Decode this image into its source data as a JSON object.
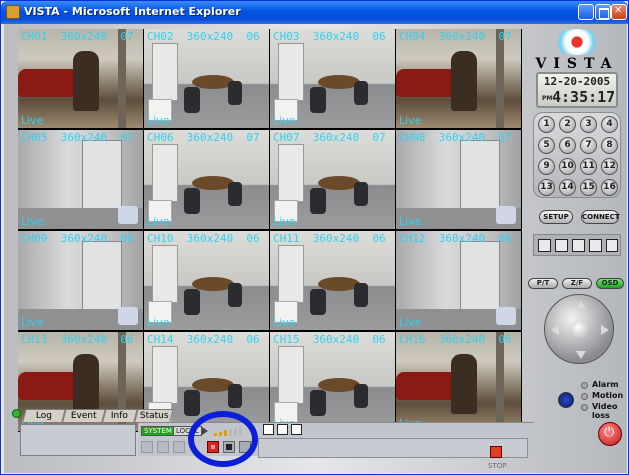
{
  "window": {
    "title": "VISTA - Microsoft Internet Explorer"
  },
  "cameras": [
    {
      "title": "CH01  360x240  07",
      "status": "Live",
      "scene": "outdoor"
    },
    {
      "title": "CH02  360x240  06",
      "status": "Live",
      "scene": "room"
    },
    {
      "title": "CH03  360x240  06",
      "status": "Live",
      "scene": "room"
    },
    {
      "title": "CH04  360x240  07",
      "status": "Live",
      "scene": "outdoor"
    },
    {
      "title": "CH05  360x240  07",
      "status": "Live",
      "scene": "hall"
    },
    {
      "title": "CH06  360x240  07",
      "status": "Live",
      "scene": "room"
    },
    {
      "title": "CH07  360x240  07",
      "status": "Live",
      "scene": "room"
    },
    {
      "title": "CH08  360x240  07",
      "status": "Live",
      "scene": "hall"
    },
    {
      "title": "CH09  360x240  06",
      "status": "Live",
      "scene": "hall"
    },
    {
      "title": "CH10  360x240  06",
      "status": "Live",
      "scene": "room"
    },
    {
      "title": "CH11  360x240  06",
      "status": "Live",
      "scene": "room"
    },
    {
      "title": "CH12  360x240  06",
      "status": "Live",
      "scene": "hall"
    },
    {
      "title": "CH13  360x240  06",
      "status": "Live",
      "scene": "outdoor"
    },
    {
      "title": "CH14  360x240  06",
      "status": "Live",
      "scene": "room"
    },
    {
      "title": "CH15  360x240  06",
      "status": "Live",
      "scene": "room"
    },
    {
      "title": "CH16  360x240  06",
      "status": "Live",
      "scene": "outdoor"
    }
  ],
  "tabs": [
    "Log",
    "Event",
    "Info",
    "Status"
  ],
  "playback": {
    "system_label": "SYSTEM",
    "local_label": "LOCAL",
    "stop_label": "STOP"
  },
  "brand": {
    "logo_text": "VISTA"
  },
  "clock": {
    "date": "12-20-2005",
    "ampm": "PM",
    "time": "4:35:17"
  },
  "keypad": [
    "1",
    "2",
    "3",
    "4",
    "5",
    "6",
    "7",
    "8",
    "9",
    "10",
    "11",
    "12",
    "13",
    "14",
    "15",
    "16"
  ],
  "buttons": {
    "setup": "SETUP",
    "connect": "CONNECT",
    "pt": "P/T",
    "zf": "Z/F",
    "osd": "OSD"
  },
  "legend": {
    "alarm": "Alarm",
    "motion": "Motion",
    "video_loss": "Video loss"
  },
  "colors": {
    "overlay_text": "#34d0f0",
    "highlight_ring": "#0b1ed8",
    "osd_button": "#23a023"
  }
}
